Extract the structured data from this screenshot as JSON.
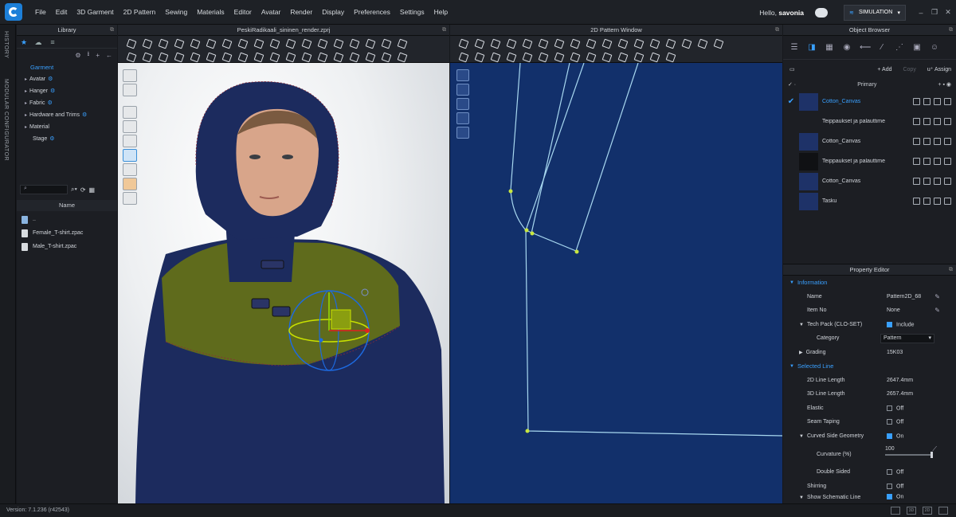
{
  "menu": [
    "File",
    "Edit",
    "3D Garment",
    "2D Pattern",
    "Sewing",
    "Materials",
    "Editor",
    "Avatar",
    "Render",
    "Display",
    "Preferences",
    "Settings",
    "Help"
  ],
  "user": {
    "greeting": "Hello,",
    "name": "savonia"
  },
  "mode": "SIMULATION",
  "window_controls": {
    "minimize": "‒",
    "restore": "❐",
    "close": "✕"
  },
  "sidebar_tabs": [
    "HISTORY",
    "MODULAR CONFIGURATOR"
  ],
  "library": {
    "title": "Library",
    "root": "Garment",
    "items": [
      "Avatar",
      "Hanger",
      "Fabric",
      "Hardware and Trims",
      "Material",
      "Stage"
    ],
    "column_header": "Name",
    "files": [
      "..",
      "Female_T-shirt.zpac",
      "Male_T-shirt.zpac"
    ]
  },
  "window3d": {
    "title": "PeskiRadikaali_sininen_render.zprj"
  },
  "window2d": {
    "title": "2D Pattern Window"
  },
  "object_browser": {
    "title": "Object Browser",
    "add_label": "+ Add",
    "copy_label": "Copy",
    "assign_label": "Assign",
    "group_label": "Primary",
    "materials": [
      {
        "name": "Cotton_Canvas",
        "swatch": "#1e3268",
        "selected": true
      },
      {
        "name": "Teippaukset ja palauttime",
        "swatch": "#1c1e23",
        "selected": false
      },
      {
        "name": "Cotton_Canvas",
        "swatch": "#1e3268",
        "selected": false
      },
      {
        "name": "Teippaukset ja palauttime",
        "swatch": "#101114",
        "selected": false
      },
      {
        "name": "Cotton_Canvas",
        "swatch": "#1e3268",
        "selected": false
      },
      {
        "name": "Tasku",
        "swatch": "#1e3268",
        "selected": false
      }
    ]
  },
  "property_editor": {
    "title": "Property Editor",
    "information": "Information",
    "name_label": "Name",
    "name_value": "Pattern2D_68",
    "item_no_label": "Item No",
    "item_no_value": "None",
    "techpack_label": "Tech Pack (CLO-SET)",
    "techpack_value": "Include",
    "category_label": "Category",
    "category_value": "Pattern",
    "grading_label": "Grading",
    "grading_value": "15K03",
    "selected_line": "Selected Line",
    "line2d_label": "2D Line Length",
    "line2d_value": "2647.4mm",
    "line3d_label": "3D Line Length",
    "line3d_value": "2657.4mm",
    "elastic_label": "Elastic",
    "elastic_value": "Off",
    "seam_taping_label": "Seam Taping",
    "seam_taping_value": "Off",
    "curved_label": "Curved Side Geometry",
    "curved_value": "On",
    "curvature_label": "Curvature (%)",
    "curvature_value": "100",
    "double_sided_label": "Double Sided",
    "double_sided_value": "Off",
    "shirring_label": "Shirring",
    "shirring_value": "Off",
    "schematic_label": "Show Schematic Line",
    "schematic_value": "On"
  },
  "status": {
    "version": "Version: 7.1.236 (r42543)"
  },
  "colors": {
    "accent": "#39a0ff",
    "pattern_bg": "#12306b",
    "pattern_line": "#a8d8f0",
    "point": "#c8e640"
  }
}
